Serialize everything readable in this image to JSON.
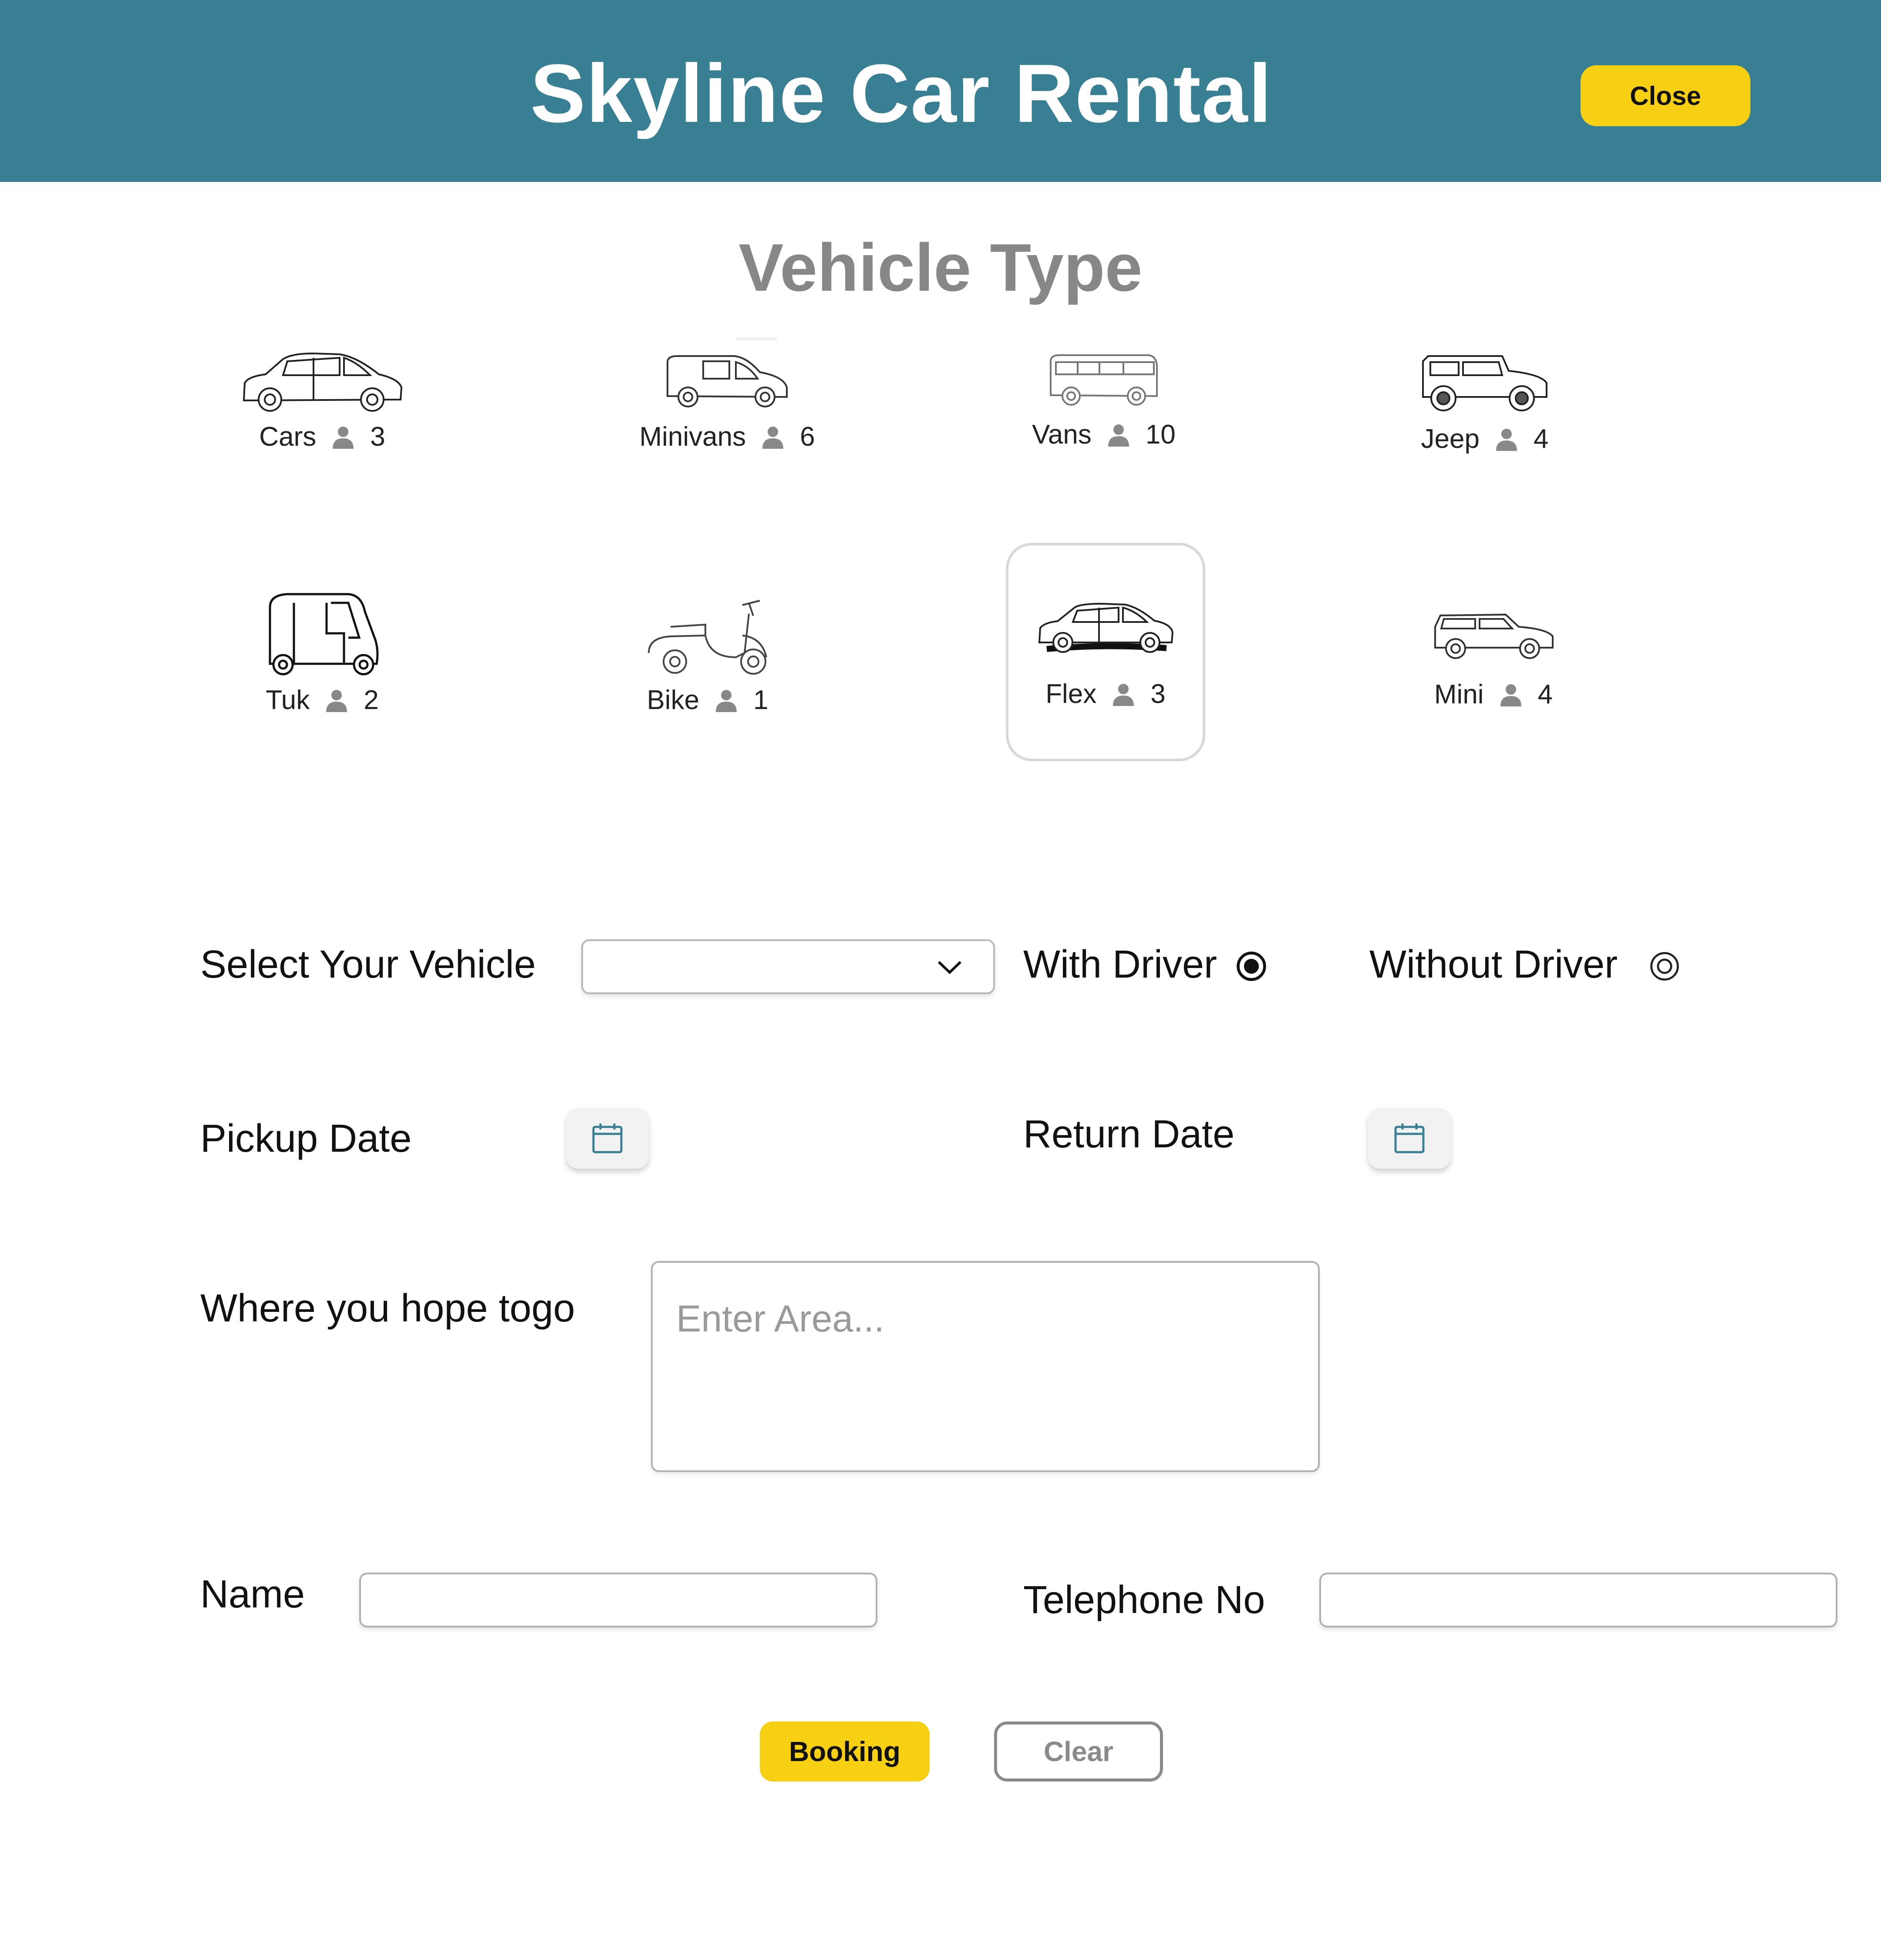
{
  "header": {
    "title": "Skyline Car Rental",
    "close_label": "Close",
    "background_color": "#387f94",
    "accent_color": "#f7d014"
  },
  "section": {
    "title": "Vehicle Type"
  },
  "vehicles": [
    {
      "name": "Cars",
      "seats": "3",
      "icon": "hatchback-car-icon",
      "selected": false
    },
    {
      "name": "Minivans",
      "seats": "6",
      "icon": "minivan-icon",
      "selected": false
    },
    {
      "name": "Vans",
      "seats": "10",
      "icon": "van-icon",
      "selected": false
    },
    {
      "name": "Jeep",
      "seats": "4",
      "icon": "jeep-icon",
      "selected": false
    },
    {
      "name": "Tuk",
      "seats": "2",
      "icon": "tuk-tuk-icon",
      "selected": false
    },
    {
      "name": "Bike",
      "seats": "1",
      "icon": "scooter-icon",
      "selected": false
    },
    {
      "name": "Flex",
      "seats": "3",
      "icon": "hatchback-car-icon",
      "selected": true
    },
    {
      "name": "Mini",
      "seats": "4",
      "icon": "suv-icon",
      "selected": false
    }
  ],
  "form": {
    "vehicle_label": "Select Your Vehicle",
    "vehicle_value": "",
    "with_driver_label": "With Driver",
    "with_driver_selected": true,
    "without_driver_label": "Without Driver",
    "without_driver_selected": false,
    "pickup_label": "Pickup Date",
    "return_label": "Return Date",
    "destination_label": "Where you hope togo",
    "destination_placeholder": "Enter Area...",
    "name_label": "Name",
    "name_value": "",
    "phone_label": "Telephone No",
    "phone_value": ""
  },
  "actions": {
    "booking_label": "Booking",
    "clear_label": "Clear"
  }
}
